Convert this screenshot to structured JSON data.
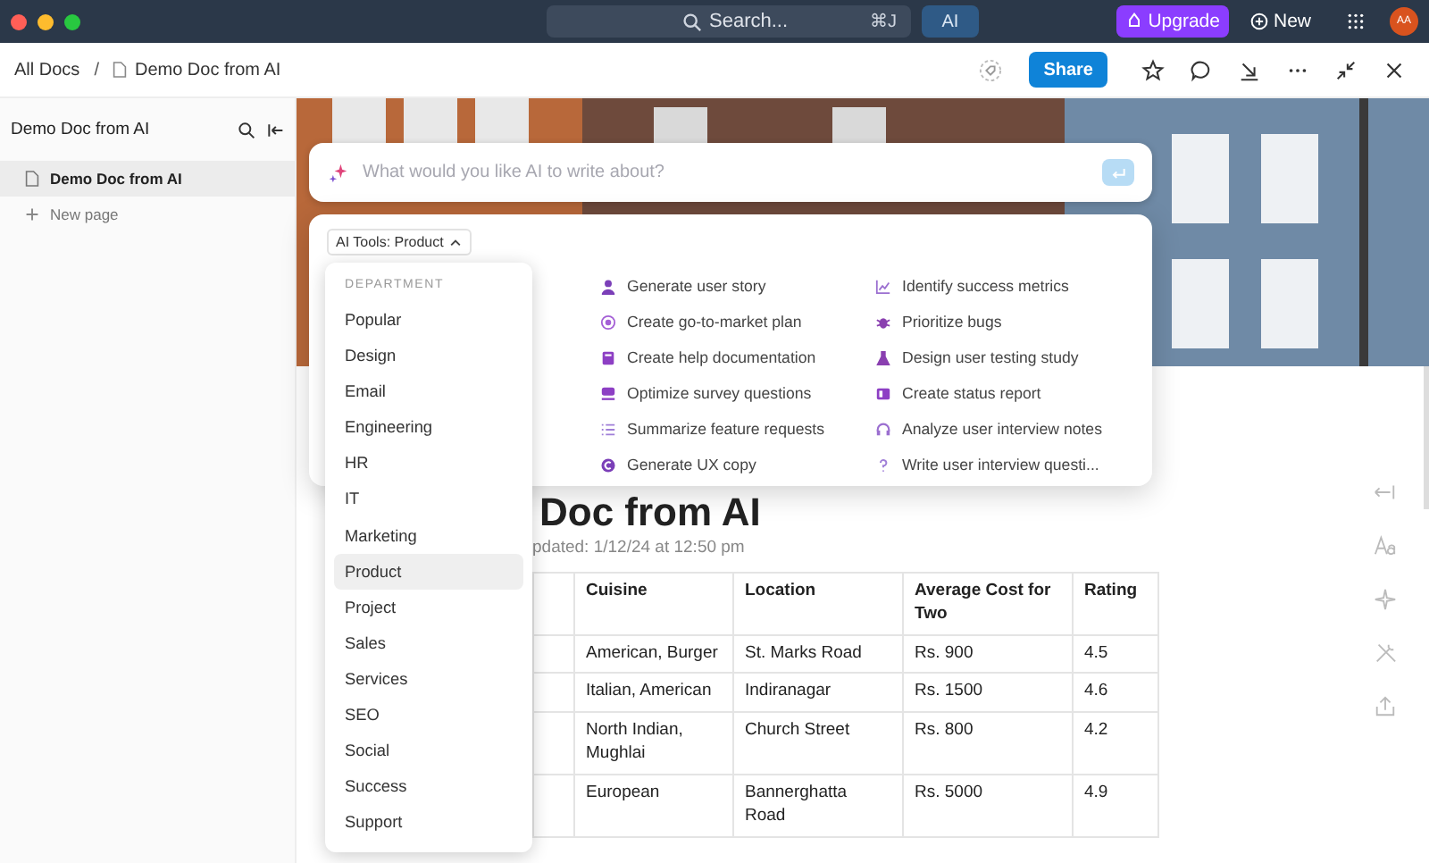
{
  "topbar": {
    "search": {
      "placeholder": "Search...",
      "shortcut": "⌘J"
    },
    "ai_button": "AI",
    "upgrade_button": "Upgrade",
    "new_button": "New",
    "avatar": "AA"
  },
  "header": {
    "breadcrumb": [
      "All Docs",
      "Demo Doc from AI"
    ],
    "separator": "/",
    "share_button": "Share"
  },
  "sidebar": {
    "title": "Demo Doc from AI",
    "pages": [
      {
        "label": "Demo Doc from AI",
        "selected": true
      }
    ],
    "new_page": "New page"
  },
  "ai_prompt": {
    "placeholder": "What would you like AI to write about?"
  },
  "ai_tools": {
    "selector": "AI Tools: Product",
    "tools": [
      {
        "label": "Generate user story",
        "kind": "person"
      },
      {
        "label": "Identify success metrics",
        "kind": "chart"
      },
      {
        "label": "Create go-to-market plan",
        "kind": "target"
      },
      {
        "label": "Prioritize bugs",
        "kind": "bug"
      },
      {
        "label": "Create help documentation",
        "kind": "book"
      },
      {
        "label": "Design user testing study",
        "kind": "flask"
      },
      {
        "label": "Optimize survey questions",
        "kind": "survey"
      },
      {
        "label": "Create status report",
        "kind": "report"
      },
      {
        "label": "Summarize feature requests",
        "kind": "list"
      },
      {
        "label": "Analyze user interview notes",
        "kind": "headset"
      },
      {
        "label": "Generate UX copy",
        "kind": "copy"
      },
      {
        "label": "Write user interview questi...",
        "kind": "question"
      }
    ]
  },
  "department_menu": {
    "heading": "DEPARTMENT",
    "items": [
      {
        "label": "Popular",
        "selected": false
      },
      {
        "label": "Design",
        "selected": false
      },
      {
        "label": "Email",
        "selected": false
      },
      {
        "label": "Engineering",
        "selected": false
      },
      {
        "label": "HR",
        "selected": false
      },
      {
        "label": "IT",
        "selected": false
      },
      {
        "label": "Marketing",
        "selected": false
      },
      {
        "label": "Product",
        "selected": true
      },
      {
        "label": "Project",
        "selected": false
      },
      {
        "label": "Sales",
        "selected": false
      },
      {
        "label": "Services",
        "selected": false
      },
      {
        "label": "SEO",
        "selected": false
      },
      {
        "label": "Social",
        "selected": false
      },
      {
        "label": "Success",
        "selected": false
      },
      {
        "label": "Support",
        "selected": false
      }
    ]
  },
  "document": {
    "title": "Doc from AI",
    "updated": "pdated: 1/12/24 at 12:50 pm",
    "table": {
      "columns": [
        "Cuisine",
        "Location",
        "Average Cost for Two",
        "Rating"
      ],
      "rows": [
        [
          "American, Burger",
          "St. Marks Road",
          "Rs. 900",
          "4.5"
        ],
        [
          "Italian, American",
          "Indiranagar",
          "Rs. 1500",
          "4.6"
        ],
        [
          "North Indian, Mughlai",
          "Church Street",
          "Rs. 800",
          "4.2"
        ],
        [
          "European",
          "Bannerghatta Road",
          "Rs. 5000",
          "4.9"
        ]
      ]
    }
  }
}
